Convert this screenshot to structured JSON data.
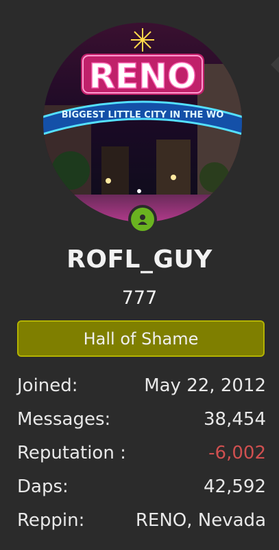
{
  "profile": {
    "avatar_sign_text": "RENO",
    "avatar_arch_text": "BIGGEST LITTLE CITY IN THE WO",
    "status_icon": "user-online-icon",
    "status_color": "#6ab320",
    "username": "ROFL_GUY",
    "user_title": "777",
    "banner": {
      "text": "Hall of Shame",
      "background": "#7f7f00",
      "border": "#b3b300"
    }
  },
  "stats": [
    {
      "label": "Joined:",
      "value": "May 22, 2012"
    },
    {
      "label": "Messages:",
      "value": "38,454"
    },
    {
      "label": "Reputation :",
      "value": "-6,002",
      "color": "#d05050"
    },
    {
      "label": "Daps:",
      "value": "42,592"
    },
    {
      "label": "Reppin:",
      "value": "RENO, Nevada"
    }
  ]
}
